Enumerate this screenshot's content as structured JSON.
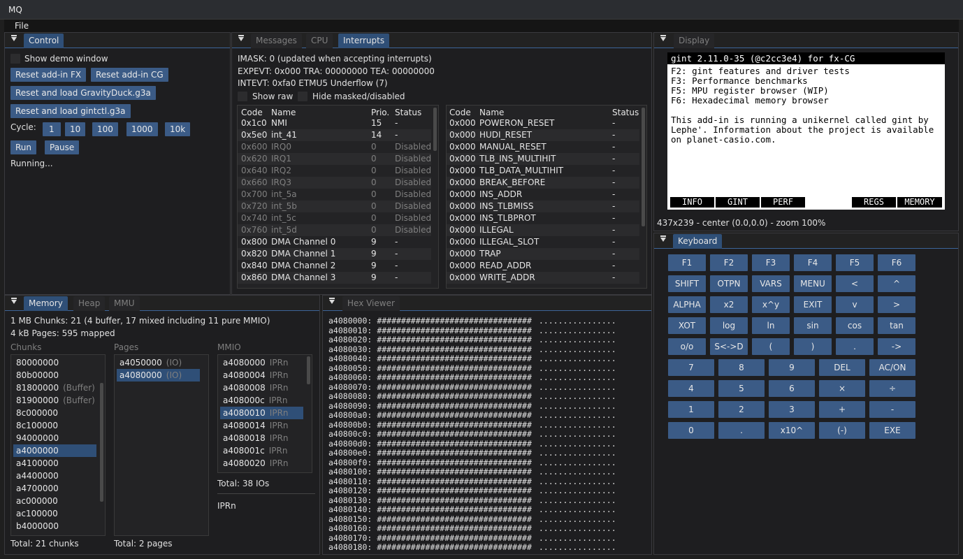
{
  "app": {
    "title": "MQ"
  },
  "menu": {
    "file": "File"
  },
  "control": {
    "tab": "Control",
    "show_demo": "Show demo window",
    "reset_fx": "Reset add-in FX",
    "reset_cg": "Reset add-in CG",
    "reset_gravity": "Reset and load GravityDuck.g3a",
    "reset_gintctl": "Reset and load gintctl.g3a",
    "cycle_label": "Cycle:",
    "cycles": [
      "1",
      "10",
      "100",
      "1000",
      "10k"
    ],
    "run": "Run",
    "pause": "Pause",
    "status": "Running..."
  },
  "messages": {
    "tabs": [
      "Messages",
      "CPU",
      "Interrupts"
    ],
    "imask": "IMASK: 0 (updated when accepting interrupts)",
    "expevt": "EXPEVT: 0x000  TRA: 00000000  TEA: 00000000",
    "intevt": "INTEVT: 0xfa0 ETMU5 Underflow (7)",
    "show_raw": "Show raw",
    "hide_masked": "Hide masked/disabled",
    "left_headers": [
      "Code",
      "Name",
      "Prio.",
      "Status"
    ],
    "left_rows": [
      {
        "code": "0x1c0",
        "name": "NMI",
        "prio": "15",
        "status": "-",
        "dim": false
      },
      {
        "code": "0x5e0",
        "name": "int_41",
        "prio": "14",
        "status": "-",
        "dim": false
      },
      {
        "code": "0x600",
        "name": "IRQ0",
        "prio": "0",
        "status": "Disabled",
        "dim": true
      },
      {
        "code": "0x620",
        "name": "IRQ1",
        "prio": "0",
        "status": "Disabled",
        "dim": true
      },
      {
        "code": "0x640",
        "name": "IRQ2",
        "prio": "0",
        "status": "Disabled",
        "dim": true
      },
      {
        "code": "0x660",
        "name": "IRQ3",
        "prio": "0",
        "status": "Disabled",
        "dim": true
      },
      {
        "code": "0x700",
        "name": "int_5a",
        "prio": "0",
        "status": "Disabled",
        "dim": true
      },
      {
        "code": "0x720",
        "name": "int_5b",
        "prio": "0",
        "status": "Disabled",
        "dim": true
      },
      {
        "code": "0x740",
        "name": "int_5c",
        "prio": "0",
        "status": "Disabled",
        "dim": true
      },
      {
        "code": "0x760",
        "name": "int_5d",
        "prio": "0",
        "status": "Disabled",
        "dim": true
      },
      {
        "code": "0x800",
        "name": "DMA Channel 0",
        "prio": "9",
        "status": "-",
        "dim": false
      },
      {
        "code": "0x820",
        "name": "DMA Channel 1",
        "prio": "9",
        "status": "-",
        "dim": false
      },
      {
        "code": "0x840",
        "name": "DMA Channel 2",
        "prio": "9",
        "status": "-",
        "dim": false
      },
      {
        "code": "0x860",
        "name": "DMA Channel 3",
        "prio": "9",
        "status": "-",
        "dim": false
      }
    ],
    "right_headers": [
      "Code",
      "Name",
      "Status"
    ],
    "right_rows": [
      {
        "code": "0x000",
        "name": "POWERON_RESET",
        "status": "-"
      },
      {
        "code": "0x000",
        "name": "HUDI_RESET",
        "status": "-"
      },
      {
        "code": "0x000",
        "name": "MANUAL_RESET",
        "status": "-"
      },
      {
        "code": "0x000",
        "name": "TLB_INS_MULTIHIT",
        "status": "-"
      },
      {
        "code": "0x000",
        "name": "TLB_DATA_MULTIHIT",
        "status": "-"
      },
      {
        "code": "0x000",
        "name": "BREAK_BEFORE",
        "status": "-"
      },
      {
        "code": "0x000",
        "name": "INS_ADDR",
        "status": "-"
      },
      {
        "code": "0x000",
        "name": "INS_TLBMISS",
        "status": "-"
      },
      {
        "code": "0x000",
        "name": "INS_TLBPROT",
        "status": "-"
      },
      {
        "code": "0x000",
        "name": "ILLEGAL",
        "status": "-"
      },
      {
        "code": "0x000",
        "name": "ILLEGAL_SLOT",
        "status": "-"
      },
      {
        "code": "0x000",
        "name": "TRAP",
        "status": "-"
      },
      {
        "code": "0x000",
        "name": "READ_ADDR",
        "status": "-"
      },
      {
        "code": "0x000",
        "name": "WRITE_ADDR",
        "status": "-"
      }
    ]
  },
  "display": {
    "tab": "Display",
    "header": "gint 2.11.0-35 (@c2cc3e4) for fx-CG",
    "lines": [
      "F2: gint features and driver tests",
      "F3: Performance benchmarks",
      "F5: MPU register browser (WIP)",
      "F6: Hexadecimal memory browser"
    ],
    "para": [
      "This add-in is running a unikernel called gint by",
      "Lephe'. Information about the project is available",
      "on planet-casio.com."
    ],
    "fkeys": [
      "INFO",
      "GINT",
      "PERF",
      "",
      "REGS",
      "MEMORY"
    ],
    "info": "437x239 - center (0.0,0.0) - zoom 100%"
  },
  "keyboard": {
    "tab": "Keyboard",
    "rows": [
      [
        "F1",
        "F2",
        "F3",
        "F4",
        "F5",
        "F6"
      ],
      [
        "SHIFT",
        "OTPN",
        "VARS",
        "MENU",
        "<",
        "^"
      ],
      [
        "ALPHA",
        "x2",
        "x^y",
        "EXIT",
        "v",
        ">"
      ],
      [
        "XOT",
        "log",
        "ln",
        "sin",
        "cos",
        "tan"
      ],
      [
        "o/o",
        "S<->D",
        "(",
        ")",
        ".",
        "->"
      ]
    ],
    "num_rows": [
      [
        "7",
        "8",
        "9",
        "DEL",
        "AC/ON"
      ],
      [
        "4",
        "5",
        "6",
        "×",
        "÷"
      ],
      [
        "1",
        "2",
        "3",
        "+",
        "-"
      ],
      [
        "0",
        ".",
        "x10^",
        "(-)",
        "EXE"
      ]
    ]
  },
  "memory": {
    "tabs": [
      "Memory",
      "Heap",
      "MMU"
    ],
    "summary1": "1 MB Chunks: 21 (4 buffer, 17 mixed including 11 pure MMIO)",
    "summary2": "4 kB Pages: 595 mapped",
    "chunks_label": "Chunks",
    "pages_label": "Pages",
    "mmio_label": "MMIO",
    "chunks": [
      {
        "addr": "80000000",
        "tag": ""
      },
      {
        "addr": "80b00000",
        "tag": ""
      },
      {
        "addr": "81800000",
        "tag": "(Buffer)"
      },
      {
        "addr": "81900000",
        "tag": "(Buffer)"
      },
      {
        "addr": "8c000000",
        "tag": ""
      },
      {
        "addr": "8c100000",
        "tag": ""
      },
      {
        "addr": "94000000",
        "tag": ""
      },
      {
        "addr": "a4000000",
        "tag": ""
      },
      {
        "addr": "a4100000",
        "tag": ""
      },
      {
        "addr": "a4400000",
        "tag": ""
      },
      {
        "addr": "a4700000",
        "tag": ""
      },
      {
        "addr": "ac000000",
        "tag": ""
      },
      {
        "addr": "ac100000",
        "tag": ""
      },
      {
        "addr": "b4000000",
        "tag": ""
      }
    ],
    "pages": [
      {
        "addr": "a4050000",
        "tag": "(IO)"
      },
      {
        "addr": "a4080000",
        "tag": "(IO)"
      }
    ],
    "mmio": [
      {
        "addr": "a4080000",
        "tag": "IPRn"
      },
      {
        "addr": "a4080004",
        "tag": "IPRn"
      },
      {
        "addr": "a4080008",
        "tag": "IPRn"
      },
      {
        "addr": "a408000c",
        "tag": "IPRn"
      },
      {
        "addr": "a4080010",
        "tag": "IPRn"
      },
      {
        "addr": "a4080014",
        "tag": "IPRn"
      },
      {
        "addr": "a4080018",
        "tag": "IPRn"
      },
      {
        "addr": "a408001c",
        "tag": "IPRn"
      },
      {
        "addr": "a4080020",
        "tag": "IPRn"
      }
    ],
    "total_chunks": "Total: 21 chunks",
    "total_pages": "Total: 2 pages",
    "total_ios": "Total: 38 IOs",
    "mmio_name": "IPRn"
  },
  "hex": {
    "tab": "Hex Viewer",
    "fill": "################################",
    "dots": "................",
    "addresses": [
      "a4080000:",
      "a4080010:",
      "a4080020:",
      "a4080030:",
      "a4080040:",
      "a4080050:",
      "a4080060:",
      "a4080070:",
      "a4080080:",
      "a4080090:",
      "a40800a0:",
      "a40800b0:",
      "a40800c0:",
      "a40800d0:",
      "a40800e0:",
      "a40800f0:",
      "a4080100:",
      "a4080110:",
      "a4080120:",
      "a4080130:",
      "a4080140:",
      "a4080150:",
      "a4080160:",
      "a4080170:",
      "a4080180:"
    ]
  }
}
